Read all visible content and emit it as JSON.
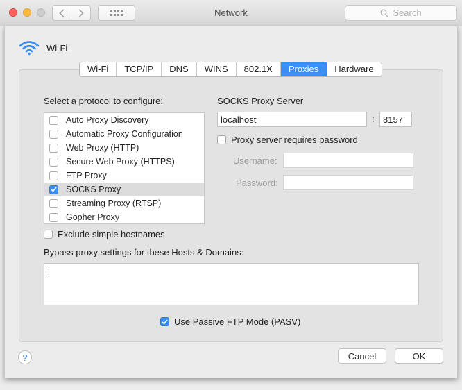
{
  "window": {
    "title": "Network",
    "search_placeholder": "Search"
  },
  "sheet": {
    "interface_name": "Wi-Fi",
    "tabs": [
      "Wi-Fi",
      "TCP/IP",
      "DNS",
      "WINS",
      "802.1X",
      "Proxies",
      "Hardware"
    ],
    "active_tab": "Proxies",
    "protocol_heading": "Select a protocol to configure:",
    "protocols": [
      {
        "label": "Auto Proxy Discovery",
        "checked": false
      },
      {
        "label": "Automatic Proxy Configuration",
        "checked": false
      },
      {
        "label": "Web Proxy (HTTP)",
        "checked": false
      },
      {
        "label": "Secure Web Proxy (HTTPS)",
        "checked": false
      },
      {
        "label": "FTP Proxy",
        "checked": false
      },
      {
        "label": "SOCKS Proxy",
        "checked": true
      },
      {
        "label": "Streaming Proxy (RTSP)",
        "checked": false
      },
      {
        "label": "Gopher Proxy",
        "checked": false
      }
    ],
    "selected_protocol": "SOCKS Proxy",
    "server_heading": "SOCKS Proxy Server",
    "server_host": "localhost",
    "port_separator": ":",
    "server_port": "8157",
    "requires_password_label": "Proxy server requires password",
    "requires_password": false,
    "username_label": "Username:",
    "username_value": "",
    "password_label": "Password:",
    "password_value": "",
    "exclude_simple_label": "Exclude simple hostnames",
    "exclude_simple": false,
    "bypass_label": "Bypass proxy settings for these Hosts & Domains:",
    "bypass_value": "",
    "passive_ftp_label": "Use Passive FTP Mode (PASV)",
    "passive_ftp": true,
    "help_label": "?",
    "cancel_label": "Cancel",
    "ok_label": "OK"
  },
  "colors": {
    "accent": "#3b8cf4",
    "close": "#fc605c",
    "minimize": "#fdbc40",
    "maximize_disabled": "#cdcdcd"
  }
}
